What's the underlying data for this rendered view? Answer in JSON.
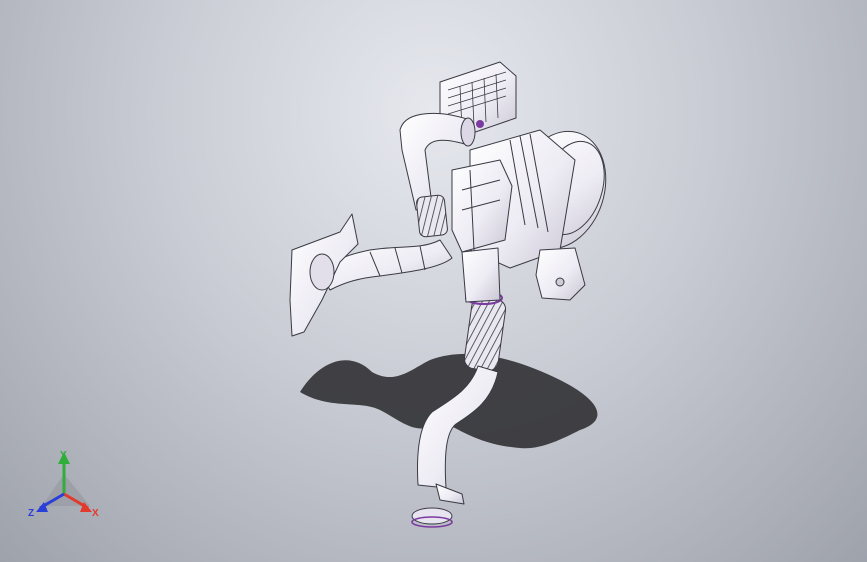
{
  "triad": {
    "x_label": "X",
    "y_label": "Y",
    "z_label": "Z",
    "x_color": "#e23a2e",
    "y_color": "#2fae3a",
    "z_color": "#2a3fd8"
  },
  "model": {
    "icon": "intake-duct-assembly",
    "fill_color": "#f2f0f6",
    "edge_color": "#3a3a44",
    "accent_color": "#7a3aa0"
  }
}
